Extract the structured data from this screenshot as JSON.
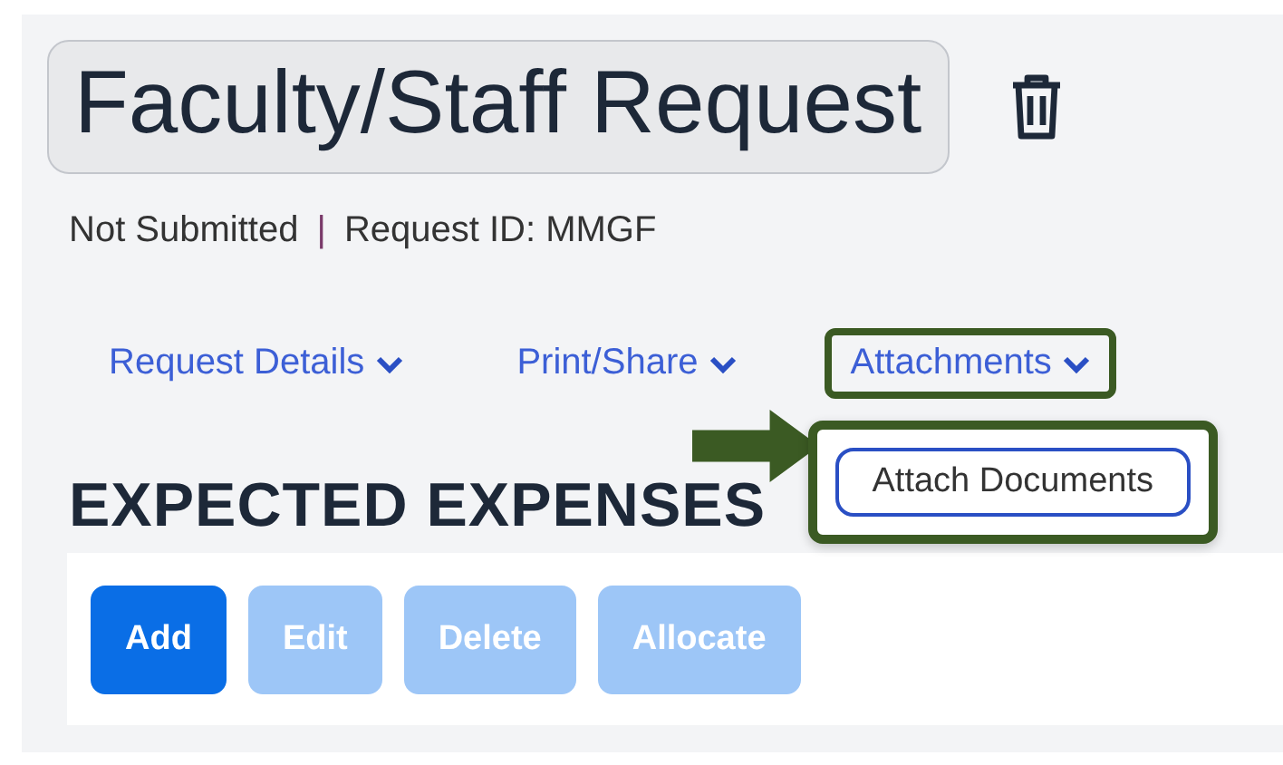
{
  "title": "Faculty/Staff Request",
  "status": "Not Submitted",
  "separator": "|",
  "request_id": "Request ID: MMGF",
  "nav_menus": [
    {
      "label": "Request Details",
      "highlighted": false
    },
    {
      "label": "Print/Share",
      "highlighted": false
    },
    {
      "label": "Attachments",
      "highlighted": true,
      "dropdown": {
        "highlighted": true,
        "items": [
          {
            "label": "Attach Documents",
            "selected": true
          }
        ]
      }
    }
  ],
  "section_heading": "EXPECTED EXPENSES",
  "buttons": [
    {
      "label": "Add",
      "disabled": false
    },
    {
      "label": "Edit",
      "disabled": true
    },
    {
      "label": "Delete",
      "disabled": true
    },
    {
      "label": "Allocate",
      "disabled": true
    }
  ]
}
